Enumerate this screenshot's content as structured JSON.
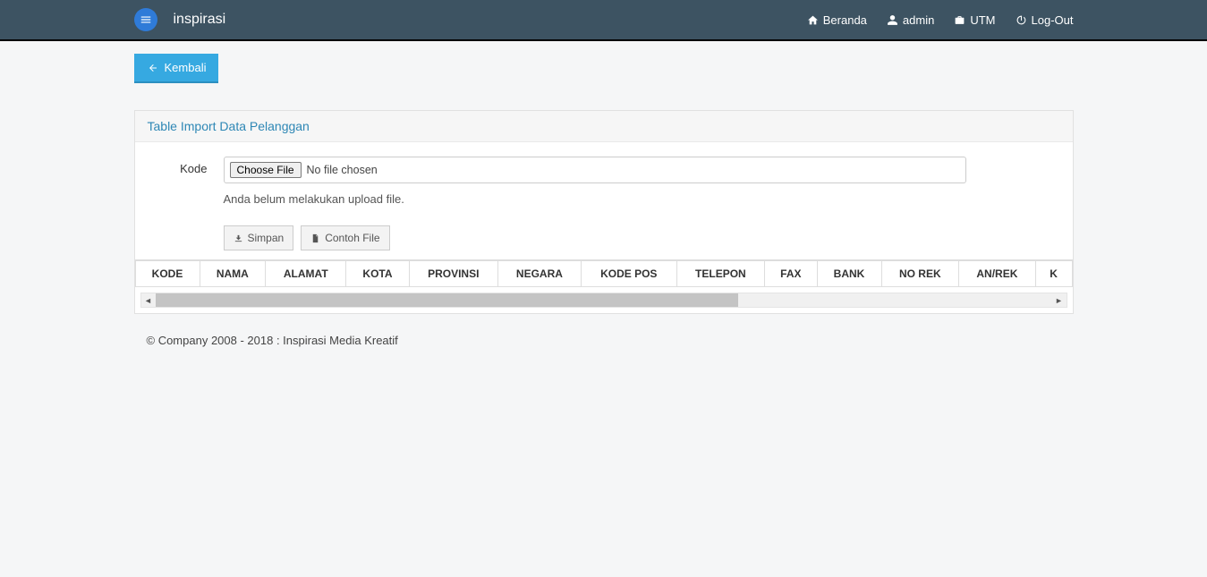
{
  "brand": "inspirasi",
  "nav": {
    "home": "Beranda",
    "user": "admin",
    "org": "UTM",
    "logout": "Log-Out"
  },
  "back_button": "Kembali",
  "panel": {
    "title": "Table Import Data Pelanggan",
    "field_label": "Kode",
    "file_button": "Choose File",
    "file_status": "No file chosen",
    "hint": "Anda belum melakukan upload file.",
    "save_button": "Simpan",
    "example_button": "Contoh File"
  },
  "table": {
    "headers": [
      "KODE",
      "NAMA",
      "ALAMAT",
      "KOTA",
      "PROVINSI",
      "NEGARA",
      "KODE POS",
      "TELEPON",
      "FAX",
      "BANK",
      "NO REK",
      "AN/REK",
      "K"
    ]
  },
  "footer": "© Company 2008 - 2018 : Inspirasi Media Kreatif"
}
